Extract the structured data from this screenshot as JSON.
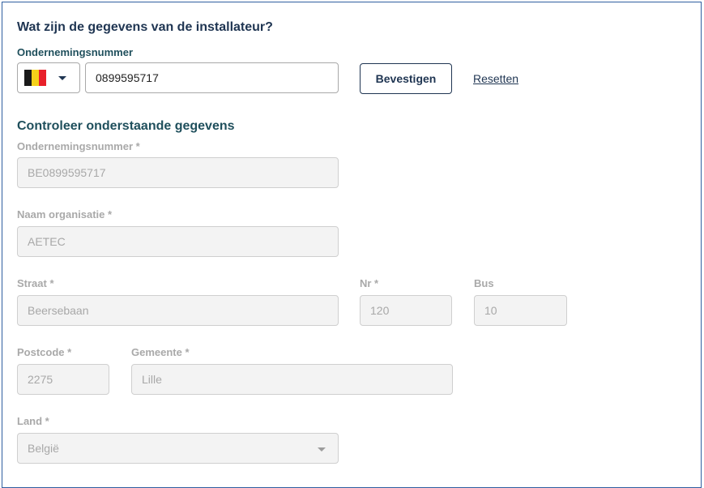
{
  "installer": {
    "heading": "Wat zijn de gegevens van de installateur?",
    "company_number_label": "Ondernemingsnummer",
    "company_number_value": "0899595717",
    "country_flag": "belgium-flag",
    "flag_colors": [
      "#1a1a1a",
      "#f4d11a",
      "#e8202a"
    ],
    "confirm_label": "Bevestigen",
    "reset_label": "Resetten"
  },
  "review": {
    "heading": "Controleer onderstaande gegevens",
    "company_number": {
      "label": "Ondernemingsnummer *",
      "value": "BE0899595717"
    },
    "org_name": {
      "label": "Naam organisatie *",
      "value": "AETEC"
    },
    "street": {
      "label": "Straat *",
      "value": "Beersebaan"
    },
    "number": {
      "label": "Nr *",
      "value": "120"
    },
    "box": {
      "label": "Bus",
      "value": "10"
    },
    "postcode": {
      "label": "Postcode *",
      "value": "2275"
    },
    "municipality": {
      "label": "Gemeente *",
      "value": "Lille"
    },
    "country": {
      "label": "Land *",
      "value": "België"
    }
  },
  "colors": {
    "heading": "#1f3552",
    "label_dark": "#1f4f5c",
    "label_disabled": "#a9a9a9",
    "frame_border": "#2f5fa0"
  }
}
